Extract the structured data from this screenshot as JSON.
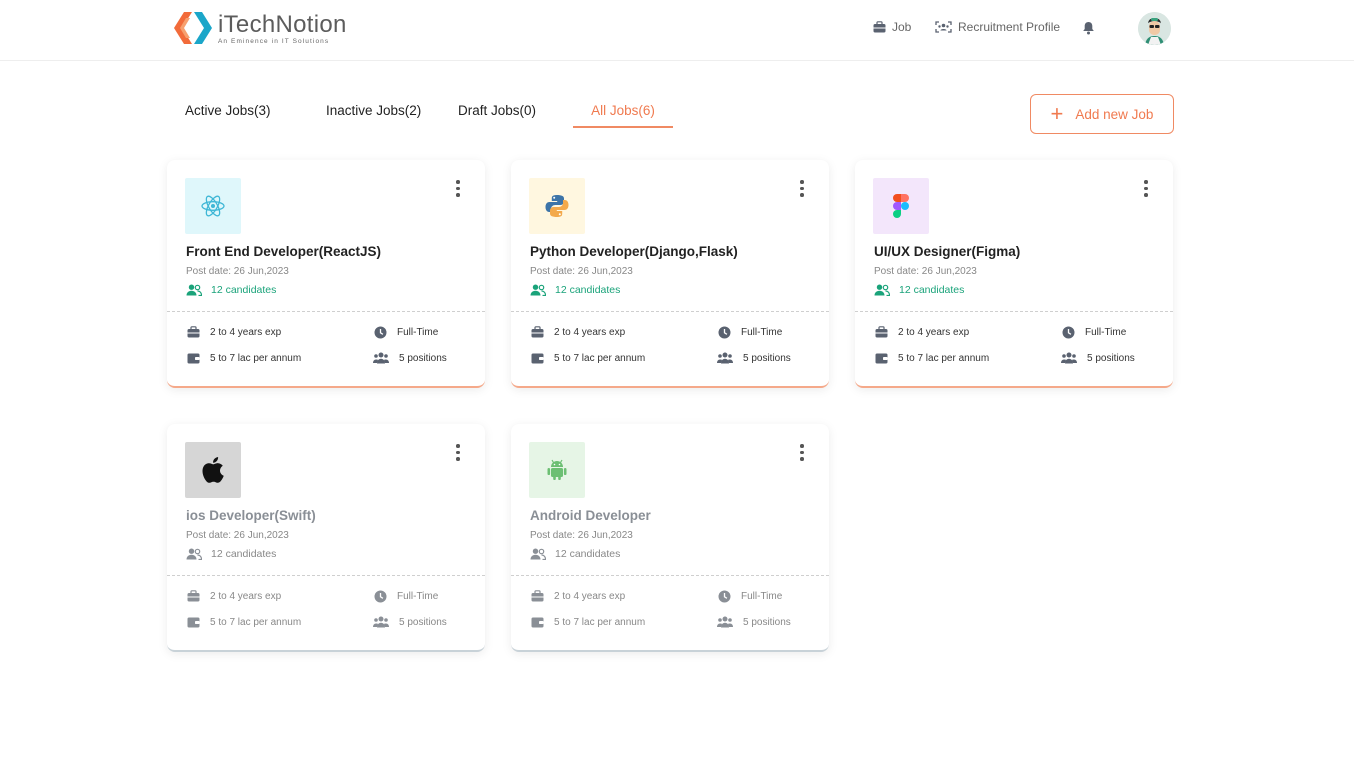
{
  "brand": {
    "name": "iTechNotion",
    "tagline": "An Eminence in IT Solutions"
  },
  "nav": {
    "job_label": "Job",
    "profile_label": "Recruitment Profile"
  },
  "tabs": [
    {
      "label": "Active Jobs(3)"
    },
    {
      "label": "Inactive Jobs(2)"
    },
    {
      "label": "Draft Jobs(0)"
    },
    {
      "label": "All Jobs(6)",
      "active": true
    }
  ],
  "add_button": {
    "label": "Add new Job"
  },
  "colors": {
    "accent": "#f07a4f",
    "success": "#1aa37a"
  },
  "jobs": [
    {
      "title": "Front End Developer(ReactJS)",
      "post_date": "Post date: 26 Jun,2023",
      "candidates": "12 candidates",
      "experience": "2 to 4 years exp",
      "type": "Full-Time",
      "salary": "5 to 7 lac per annum",
      "positions": "5 positions",
      "icon": "react-icon",
      "status": "active"
    },
    {
      "title": "Python Developer(Django,Flask)",
      "post_date": "Post date: 26 Jun,2023",
      "candidates": "12 candidates",
      "experience": "2 to 4 years exp",
      "type": "Full-Time",
      "salary": "5 to 7 lac per annum",
      "positions": "5 positions",
      "icon": "python-icon",
      "status": "active"
    },
    {
      "title": "UI/UX Designer(Figma)",
      "post_date": "Post date: 26 Jun,2023",
      "candidates": "12 candidates",
      "experience": "2 to 4 years exp",
      "type": "Full-Time",
      "salary": "5 to 7 lac per annum",
      "positions": "5 positions",
      "icon": "figma-icon",
      "status": "active"
    },
    {
      "title": "ios Developer(Swift)",
      "post_date": "Post date: 26 Jun,2023",
      "candidates": "12 candidates",
      "experience": "2 to 4 years exp",
      "type": "Full-Time",
      "salary": "5 to 7 lac per annum",
      "positions": "5 positions",
      "icon": "apple-icon",
      "status": "inactive"
    },
    {
      "title": "Android Developer",
      "post_date": "Post date: 26 Jun,2023",
      "candidates": "12 candidates",
      "experience": "2 to 4 years exp",
      "type": "Full-Time",
      "salary": "5 to 7 lac per annum",
      "positions": "5 positions",
      "icon": "android-icon",
      "status": "inactive"
    }
  ]
}
